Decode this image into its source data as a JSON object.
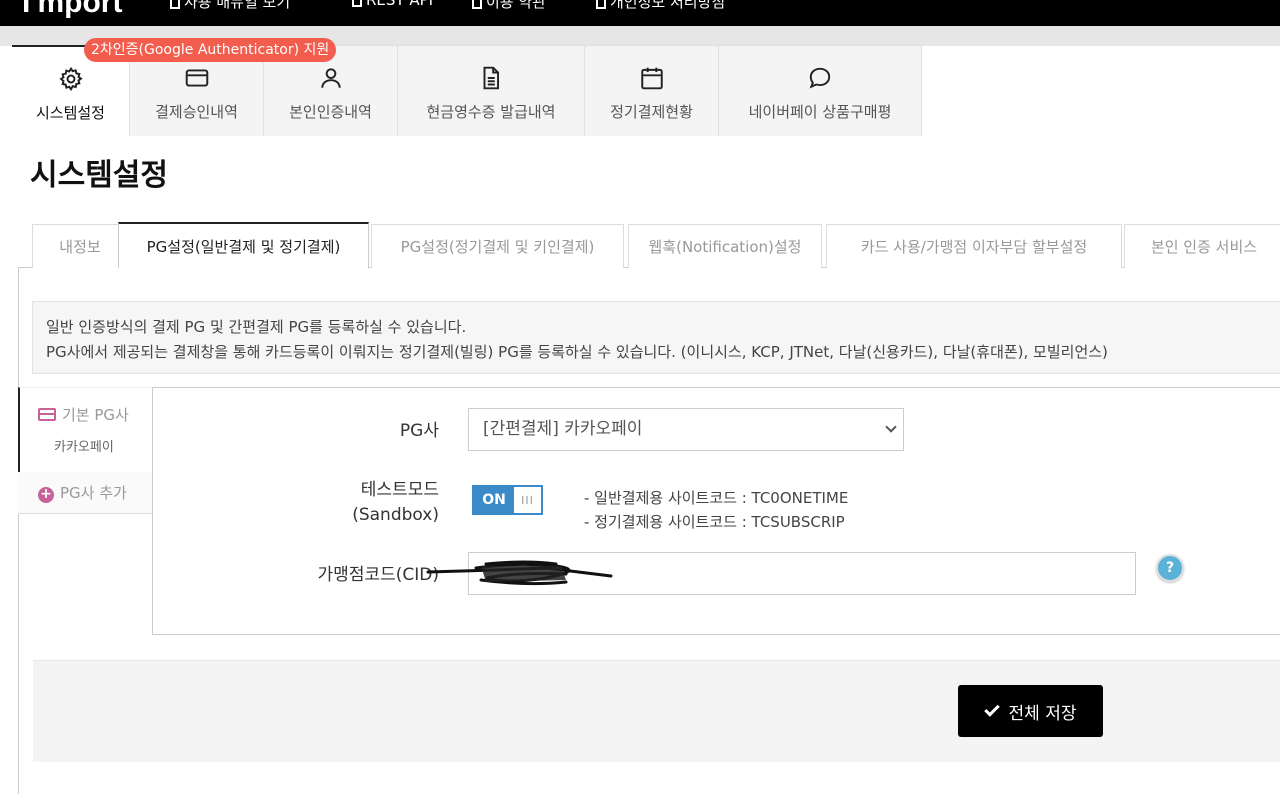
{
  "topnav": {
    "brand": "I'mport",
    "links": [
      "사용 매뉴얼 보기",
      "REST API",
      "이용 약관",
      "개인정보 처리방침"
    ]
  },
  "badge": "2차인증(Google Authenticator) 지원",
  "menu": [
    {
      "label": "시스템설정",
      "icon": "gear-icon"
    },
    {
      "label": "결제승인내역",
      "icon": "credit-card-icon"
    },
    {
      "label": "본인인증내역",
      "icon": "user-icon"
    },
    {
      "label": "현금영수증 발급내역",
      "icon": "document-icon"
    },
    {
      "label": "정기결제현황",
      "icon": "calendar-icon"
    },
    {
      "label": "네이버페이 상품구매평",
      "icon": "chat-bubble-icon"
    }
  ],
  "page_title": "시스템설정",
  "subtabs": [
    "내정보",
    "PG설정(일반결제 및 정기결제)",
    "PG설정(정기결제 및 키인결제)",
    "웹훅(Notification)설정",
    "카드 사용/가맹점 이자부담 할부설정",
    "본인 인증 서비스"
  ],
  "info": {
    "line1": "일반 인증방식의 결제 PG 및 간편결제 PG를 등록하실 수 있습니다.",
    "line2": "PG사에서 제공되는 결제창을 통해 카드등록이 이뤄지는 정기결제(빌링) PG를 등록하실 수 있습니다. (이니시스, KCP, JTNet, 다날(신용카드), 다날(휴대폰), 모빌리언스)"
  },
  "pg_list": {
    "default_title": "기본 PG사",
    "default_sub": "카카오페이",
    "add_label": "PG사 추가"
  },
  "form": {
    "pg_label": "PG사",
    "pg_value": "[간편결제] 카카오페이",
    "testmode_label_1": "테스트모드",
    "testmode_label_2": "(Sandbox)",
    "toggle_on": "ON",
    "toggle_knob": "III",
    "sitecode_1": "- 일반결제용 사이트코드 : TC0ONETIME",
    "sitecode_2": "- 정기결제용 사이트코드 : TCSUBSCRIP",
    "cid_label": "가맹점코드(CID)",
    "help": "?"
  },
  "save_label": "전체 저장",
  "colors": {
    "accent_blue": "#3a8ac8",
    "badge_red": "#f25d4e",
    "pink_icon": "#c8609a",
    "help_blue": "#5bb2d9"
  }
}
